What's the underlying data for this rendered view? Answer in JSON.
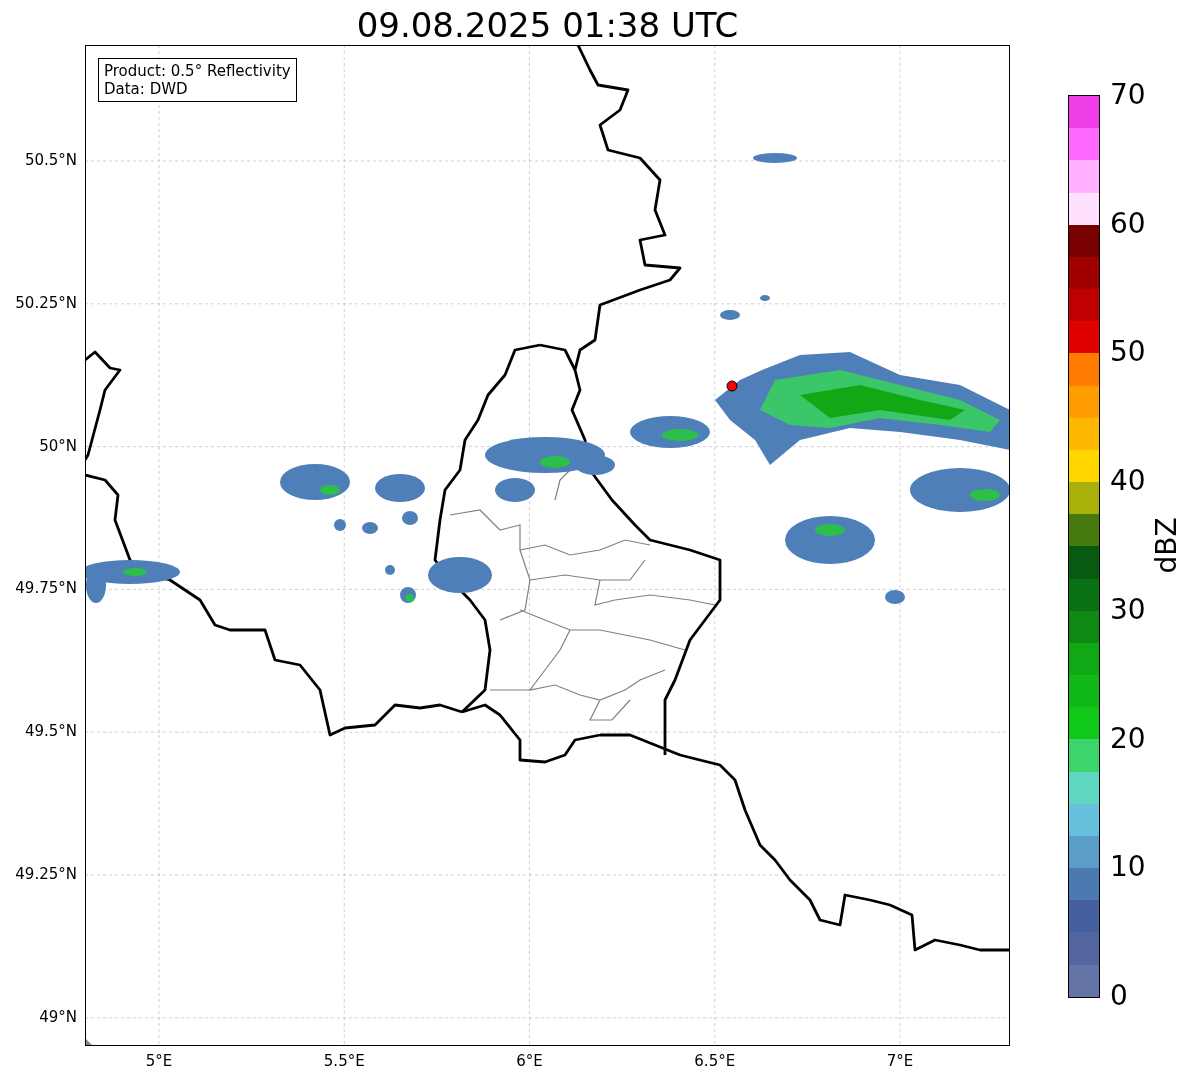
{
  "title": "09.08.2025 01:38 UTC",
  "info_box": [
    "Product: 0.5° Reflectivity",
    "Data: DWD"
  ],
  "lat_ticks": [
    "50.5°N",
    "50.25°N",
    "50°N",
    "49.75°N",
    "49.5°N",
    "49.25°N",
    "49°N"
  ],
  "lon_ticks": [
    "5°E",
    "5.5°E",
    "6°E",
    "6.5°E",
    "7°E"
  ],
  "colorbar": {
    "label": "dBZ",
    "ticks": [
      "70",
      "60",
      "50",
      "40",
      "30",
      "20",
      "10",
      "0"
    ],
    "segments": [
      {
        "color": "#ee3ee8"
      },
      {
        "color": "#ff68ff"
      },
      {
        "color": "#ffb0ff"
      },
      {
        "color": "#ffe0ff"
      },
      {
        "color": "#780000"
      },
      {
        "color": "#a00000"
      },
      {
        "color": "#c00000"
      },
      {
        "color": "#e00000"
      },
      {
        "color": "#ff7c00"
      },
      {
        "color": "#ff9c00"
      },
      {
        "color": "#ffb800"
      },
      {
        "color": "#ffd600"
      },
      {
        "color": "#aab00a"
      },
      {
        "color": "#467a0e"
      },
      {
        "color": "#085a10"
      },
      {
        "color": "#0a7014"
      },
      {
        "color": "#0e8a14"
      },
      {
        "color": "#10a814"
      },
      {
        "color": "#10b818"
      },
      {
        "color": "#10c818"
      },
      {
        "color": "#3cd46c"
      },
      {
        "color": "#5fd6c0"
      },
      {
        "color": "#66c2dc"
      },
      {
        "color": "#5a9ec8"
      },
      {
        "color": "#4a7ab0"
      },
      {
        "color": "#4560a0"
      },
      {
        "color": "#5466a0"
      },
      {
        "color": "#6474a6"
      }
    ]
  }
}
